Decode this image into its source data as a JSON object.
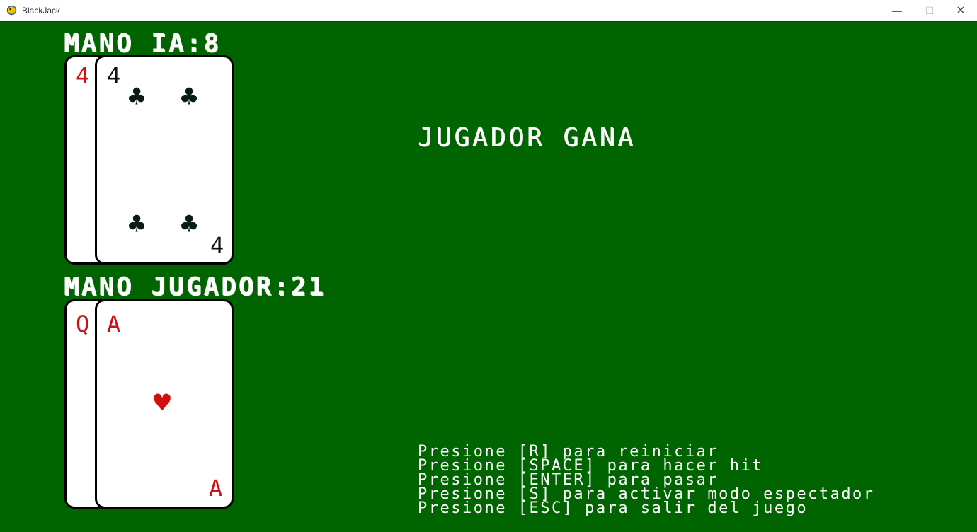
{
  "window": {
    "title": "BlackJack",
    "minimize_glyph": "—",
    "maximize_glyph": "☐",
    "close_glyph": "✕"
  },
  "ai_hand": {
    "label": "MANO IA:8",
    "cards": [
      {
        "rank": "4",
        "color": "#d01010"
      },
      {
        "rank": "4",
        "suit": "♣",
        "color": "#111111"
      }
    ]
  },
  "player_hand": {
    "label": "MANO JUGADOR:21",
    "cards": [
      {
        "rank": "Q",
        "color": "#d01010"
      },
      {
        "rank": "A",
        "suit": "♥",
        "color": "#d01010"
      }
    ]
  },
  "result": "JUGADOR GANA",
  "instructions": [
    "Presione [R] para reiniciar",
    "Presione [SPACE] para hacer hit",
    "Presione [ENTER] para pasar",
    "Presione [S] para activar modo espectador",
    "Presione [ESC] para salir del juego"
  ],
  "colors": {
    "table": "#006400",
    "text": "#ffffff",
    "red_suit": "#d01010"
  },
  "icons": {
    "app": "pygame-snake-icon"
  }
}
